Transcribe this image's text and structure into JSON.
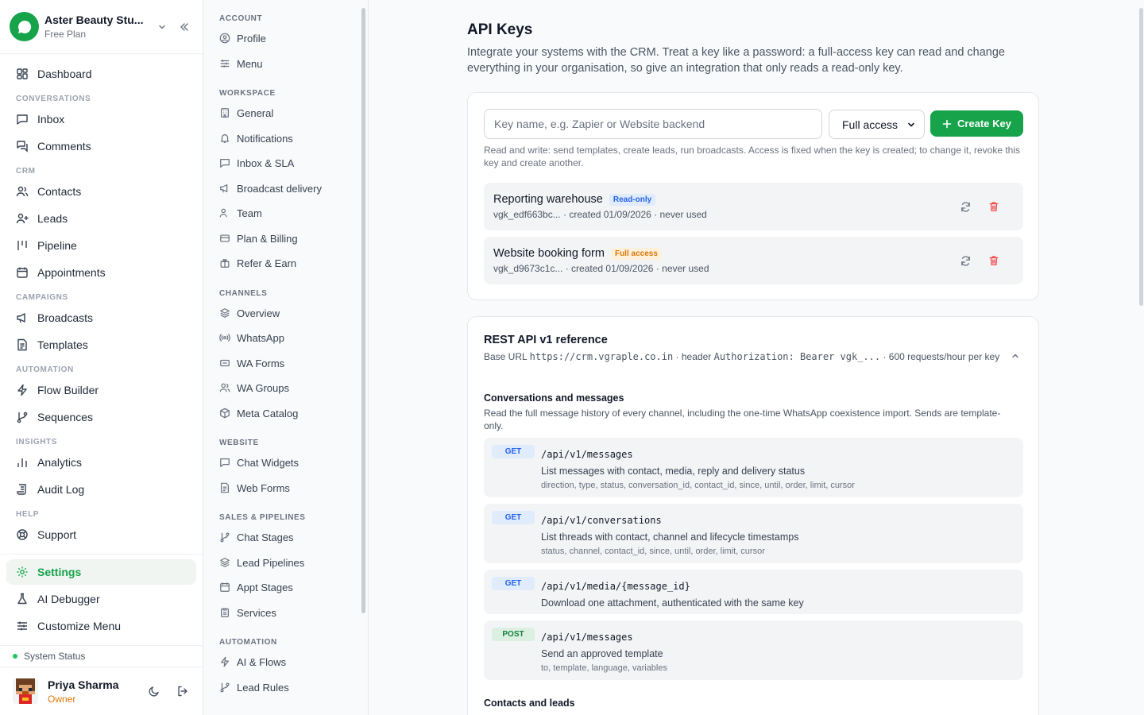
{
  "colors": {
    "accent": "#16a34a",
    "read_only": "#2563eb",
    "full_access": "#d97706",
    "danger": "#ef4444"
  },
  "brand": {
    "name": "Aster Beauty Stu...",
    "plan": "Free Plan"
  },
  "sidebar": {
    "dashboard": "Dashboard",
    "sections": {
      "conversations": "CONVERSATIONS",
      "crm": "CRM",
      "campaigns": "CAMPAIGNS",
      "automation": "AUTOMATION",
      "insights": "INSIGHTS",
      "help": "HELP"
    },
    "items": {
      "inbox": "Inbox",
      "comments": "Comments",
      "contacts": "Contacts",
      "leads": "Leads",
      "pipeline": "Pipeline",
      "appointments": "Appointments",
      "broadcasts": "Broadcasts",
      "templates": "Templates",
      "flow_builder": "Flow Builder",
      "sequences": "Sequences",
      "analytics": "Analytics",
      "audit_log": "Audit Log",
      "support": "Support",
      "settings": "Settings",
      "ai_debugger": "AI Debugger",
      "customize_menu": "Customize Menu"
    },
    "system_status": "System Status",
    "user": {
      "name": "Priya Sharma",
      "role": "Owner"
    }
  },
  "subnav": {
    "sections": {
      "account": "ACCOUNT",
      "workspace": "WORKSPACE",
      "channels": "CHANNELS",
      "website": "WEBSITE",
      "sales": "SALES & PIPELINES",
      "automation": "AUTOMATION"
    },
    "items": {
      "profile": "Profile",
      "menu": "Menu",
      "general": "General",
      "notifications": "Notifications",
      "inbox_sla": "Inbox & SLA",
      "broadcast_delivery": "Broadcast delivery",
      "team": "Team",
      "plan_billing": "Plan & Billing",
      "refer_earn": "Refer & Earn",
      "overview": "Overview",
      "whatsapp": "WhatsApp",
      "wa_forms": "WA Forms",
      "wa_groups": "WA Groups",
      "meta_catalog": "Meta Catalog",
      "chat_widgets": "Chat Widgets",
      "web_forms": "Web Forms",
      "chat_stages": "Chat Stages",
      "lead_pipelines": "Lead Pipelines",
      "appt_stages": "Appt Stages",
      "services": "Services",
      "ai_flows": "AI & Flows",
      "lead_rules": "Lead Rules"
    }
  },
  "page": {
    "title": "API Keys",
    "description": "Integrate your systems with the CRM. Treat a key like a password: a full-access key can read and change everything in your organisation, so give an integration that only reads a read-only key."
  },
  "create": {
    "placeholder": "Key name, e.g. Zapier or Website backend",
    "access_value": "Full access",
    "button": "Create Key",
    "helper": "Read and write: send templates, create leads, run broadcasts. Access is fixed when the key is created; to change it, revoke this key and create another."
  },
  "keys": [
    {
      "name": "Reporting warehouse",
      "badge": "Read-only",
      "meta": "vgk_edf663bc... · created 01/09/2026 · never used"
    },
    {
      "name": "Website booking form",
      "badge": "Full access",
      "meta": "vgk_d9673c1c... · created 01/09/2026 · never used"
    }
  ],
  "reference": {
    "title": "REST API v1 reference",
    "base_prefix": "Base URL ",
    "base_url": "https://crm.vgraple.co.in",
    "base_mid": " · header ",
    "base_header": "Authorization: Bearer vgk_...",
    "base_suffix": " · 600 requests/hour per key",
    "group1_title": "Conversations and messages",
    "group1_desc": "Read the full message history of every channel, including the one-time WhatsApp coexistence import. Sends are template-only.",
    "endpoints": [
      {
        "method": "GET",
        "path": "/api/v1/messages",
        "desc": "List messages with contact, media, reply and delivery status",
        "params": "direction, type, status, conversation_id, contact_id, since, until, order, limit, cursor"
      },
      {
        "method": "GET",
        "path": "/api/v1/conversations",
        "desc": "List threads with contact, channel and lifecycle timestamps",
        "params": "status, channel, contact_id, since, until, order, limit, cursor"
      },
      {
        "method": "GET",
        "path": "/api/v1/media/{message_id}",
        "desc": "Download one attachment, authenticated with the same key",
        "params": ""
      },
      {
        "method": "POST",
        "path": "/api/v1/messages",
        "desc": "Send an approved template",
        "params": "to, template, language, variables"
      }
    ],
    "group2_title": "Contacts and leads"
  }
}
